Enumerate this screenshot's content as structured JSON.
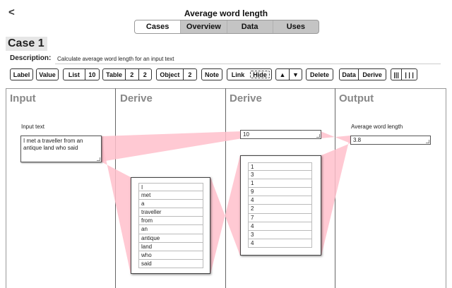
{
  "header": {
    "back_label": "<",
    "title": "Average word length"
  },
  "tabs": [
    {
      "label": "Cases",
      "active": true
    },
    {
      "label": "Overview",
      "active": false
    },
    {
      "label": "Data",
      "active": false
    },
    {
      "label": "Uses",
      "active": false
    }
  ],
  "case": {
    "title": "Case 1",
    "description_label": "Description:",
    "description_value": "Calculate average word length for an input text"
  },
  "toolbar": {
    "label": "Label",
    "value": "Value",
    "list": "List",
    "list_count": "10",
    "table": "Table",
    "table_rows": "2",
    "table_cols": "2",
    "object": "Object",
    "object_count": "2",
    "note": "Note",
    "link": "Link",
    "hide": "Hide",
    "up": "▲",
    "down": "▼",
    "delete": "Delete",
    "data": "Data",
    "derive": "Derive",
    "cols_3": "|||",
    "cols_4": "| | |"
  },
  "columns": [
    {
      "heading": "Input"
    },
    {
      "heading": "Derive"
    },
    {
      "heading": "Derive"
    },
    {
      "heading": "Output"
    }
  ],
  "input_panel": {
    "label": "Input text",
    "text": "I met a traveller from an antique land who said"
  },
  "derive1": {
    "words": [
      "I",
      "met",
      "a",
      "traveller",
      "from",
      "an",
      "antique",
      "land",
      "who",
      "said"
    ]
  },
  "derive2": {
    "count_value": "10",
    "lengths": [
      "1",
      "3",
      "1",
      "9",
      "4",
      "2",
      "7",
      "4",
      "3",
      "4"
    ]
  },
  "output_panel": {
    "label": "Average word length",
    "value": "3.8"
  },
  "colors": {
    "link_fill": "#ffc0cb",
    "column_heading": "#888888",
    "active_tab": "#ffffff",
    "inactive_tab": "#c4c4c4"
  }
}
